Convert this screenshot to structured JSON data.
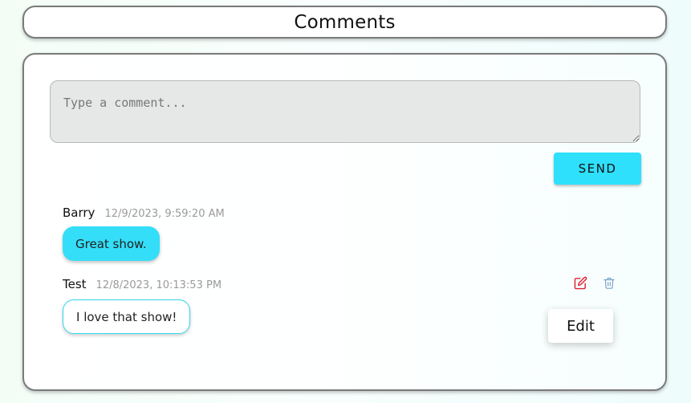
{
  "header": {
    "title": "Comments"
  },
  "composer": {
    "placeholder": "Type a comment...",
    "send_label": "SEND"
  },
  "comments": [
    {
      "author": "Barry",
      "timestamp": "12/9/2023, 9:59:20 AM",
      "text": "Great show."
    },
    {
      "author": "Test",
      "timestamp": "12/8/2023, 10:13:53 PM",
      "text": "I love that show!"
    }
  ],
  "actions": {
    "edit_icon": "edit-icon",
    "delete_icon": "trash-icon",
    "edit_tooltip": "Edit"
  },
  "colors": {
    "accent": "#2ee0fb",
    "edit_icon": "#e0202f",
    "delete_icon": "#7aa3c8"
  }
}
